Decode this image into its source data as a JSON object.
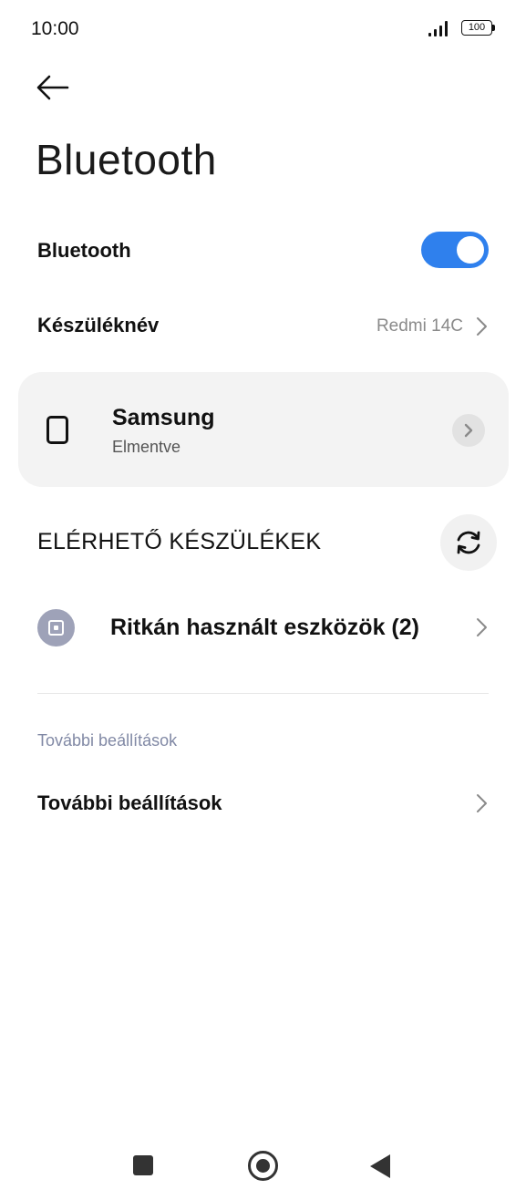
{
  "status_bar": {
    "time": "10:00",
    "battery": "100",
    "signal_icon": "signal-bars-icon",
    "battery_icon": "battery-icon"
  },
  "header": {
    "back_icon": "arrow-left-icon",
    "title": "Bluetooth"
  },
  "bluetooth_toggle": {
    "label": "Bluetooth",
    "enabled": true,
    "accent_color": "#2f80ed"
  },
  "device_name": {
    "label": "Készüléknév",
    "value": "Redmi 14C"
  },
  "saved_device": {
    "name": "Samsung",
    "status": "Elmentve",
    "icon": "phone-icon"
  },
  "available": {
    "title": "ELÉRHETŐ KÉSZÜLÉKEK",
    "refresh_icon": "refresh-icon"
  },
  "rare_devices": {
    "label": "Ritkán használt eszközök (2)",
    "icon": "device-box-icon"
  },
  "more_settings": {
    "subheader": "További beállítások",
    "label": "További beállítások"
  },
  "nav_bar": {
    "recents_icon": "square-icon",
    "home_icon": "circle-home-icon",
    "back_icon": "triangle-back-icon"
  }
}
